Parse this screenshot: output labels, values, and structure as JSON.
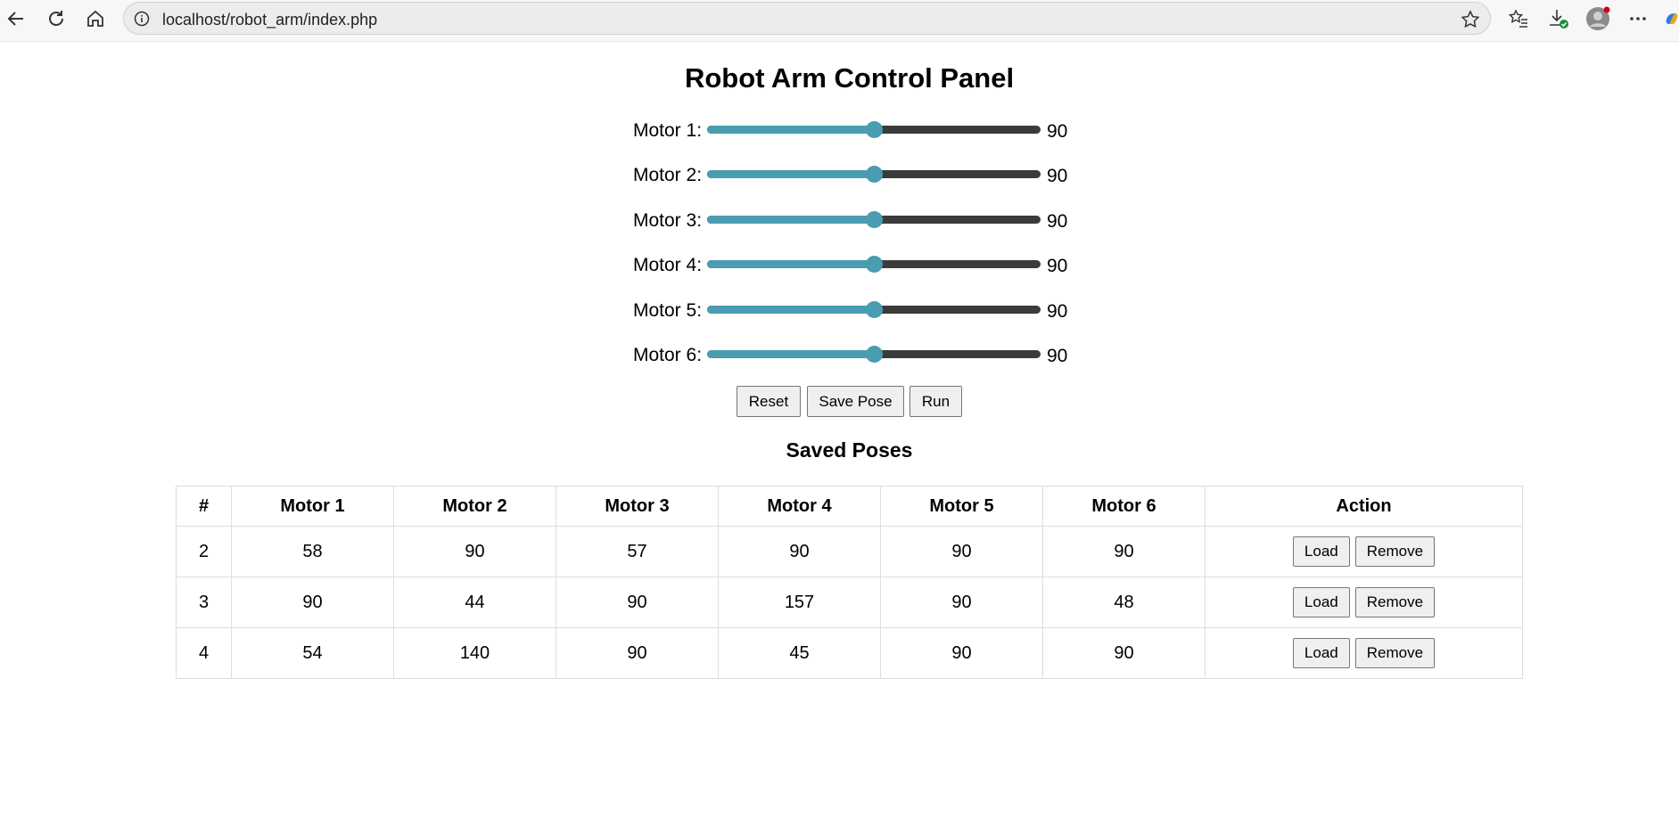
{
  "browser": {
    "url": "localhost/robot_arm/index.php"
  },
  "page": {
    "title": "Robot Arm Control Panel",
    "motors": [
      {
        "label": "Motor 1:",
        "value": "90",
        "fraction": 0.5
      },
      {
        "label": "Motor 2:",
        "value": "90",
        "fraction": 0.5
      },
      {
        "label": "Motor 3:",
        "value": "90",
        "fraction": 0.5
      },
      {
        "label": "Motor 4:",
        "value": "90",
        "fraction": 0.5
      },
      {
        "label": "Motor 5:",
        "value": "90",
        "fraction": 0.5
      },
      {
        "label": "Motor 6:",
        "value": "90",
        "fraction": 0.5
      }
    ],
    "buttons": {
      "reset": "Reset",
      "save_pose": "Save Pose",
      "run": "Run"
    },
    "saved_title": "Saved Poses",
    "table": {
      "headers": [
        "#",
        "Motor 1",
        "Motor 2",
        "Motor 3",
        "Motor 4",
        "Motor 5",
        "Motor 6",
        "Action"
      ],
      "rows": [
        [
          "2",
          "58",
          "90",
          "57",
          "90",
          "90",
          "90"
        ],
        [
          "3",
          "90",
          "44",
          "90",
          "157",
          "90",
          "48"
        ],
        [
          "4",
          "54",
          "140",
          "90",
          "45",
          "90",
          "90"
        ]
      ],
      "load_label": "Load",
      "remove_label": "Remove"
    }
  },
  "colors": {
    "slider_accent": "#4a9cb0",
    "slider_track": "#3b3b3b"
  }
}
